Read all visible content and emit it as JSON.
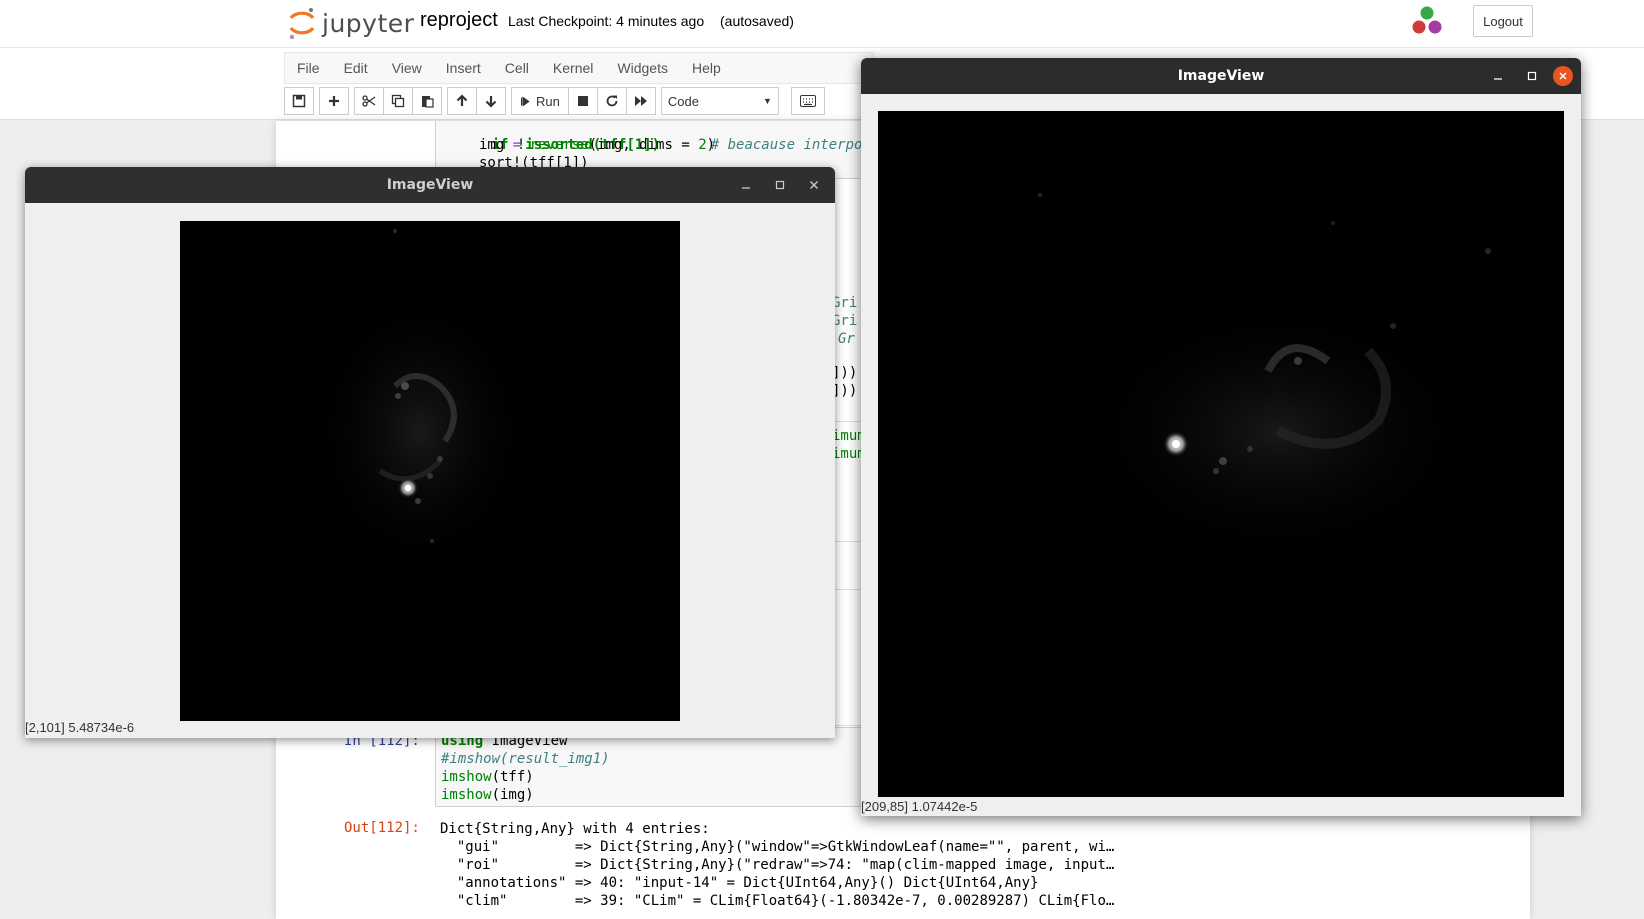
{
  "header": {
    "logo_text": "jupyter",
    "notebook_name": "reproject",
    "checkpoint": "Last Checkpoint: 4 minutes ago",
    "autosave": "(autosaved)",
    "logout_label": "Logout"
  },
  "menubar": {
    "items": [
      "File",
      "Edit",
      "View",
      "Insert",
      "Cell",
      "Kernel",
      "Widgets",
      "Help"
    ]
  },
  "toolbar": {
    "run_label": "Run",
    "cell_type": "Code"
  },
  "notebook": {
    "cell1": {
      "line1_a": "if !issorted(tff[1])",
      "line1_comment": "# beacause interpola",
      "line2_a": "img",
      "line2_b": " = ",
      "line2_c": "reverse",
      "line2_d": "(img, dims = ",
      "line2_e": "2",
      "line2_f": ")",
      "line3": "sort!(tff[1])"
    },
    "fragments": [
      "Gri",
      "Gri",
      "Gr",
      "]))",
      "]))",
      "imum",
      "imum"
    ],
    "cell2": {
      "prompt": "In [112]:",
      "line1_kw": "using",
      "line1_rest": " ImageView",
      "line2": "#imshow(result_img1)",
      "line3_fn": "imshow",
      "line3_rest": "(tff)",
      "line4_fn": "imshow",
      "line4_rest": "(img)"
    },
    "output": {
      "prompt": "Out[112]:",
      "lines": [
        "Dict{String,Any} with 4 entries:",
        "  \"gui\"         => Dict{String,Any}(\"window\"=>GtkWindowLeaf(name=\"\", parent, wi…",
        "  \"roi\"         => Dict{String,Any}(\"redraw\"=>74: \"map(clim-mapped image, input…",
        "  \"annotations\" => 40: \"input-14\" = Dict{UInt64,Any}() Dict{UInt64,Any}",
        "  \"clim\"        => 39: \"CLim\" = CLim{Float64}(-1.80342e-7, 0.00289287) CLim{Flo…"
      ]
    }
  },
  "imageview_left": {
    "title": "ImageView",
    "status": "[2,101] 5.48734e-6",
    "title_color": "#cfcfcf"
  },
  "imageview_right": {
    "title": "ImageView",
    "status": "[209,85] 1.07442e-5",
    "title_color": "#ffffff",
    "close_color": "#e95420"
  },
  "colors": {
    "jupyter_orange": "#f37726",
    "kernel_green": "#3aa648",
    "kernel_red": "#d23a3a",
    "kernel_purple": "#a33ca3"
  }
}
